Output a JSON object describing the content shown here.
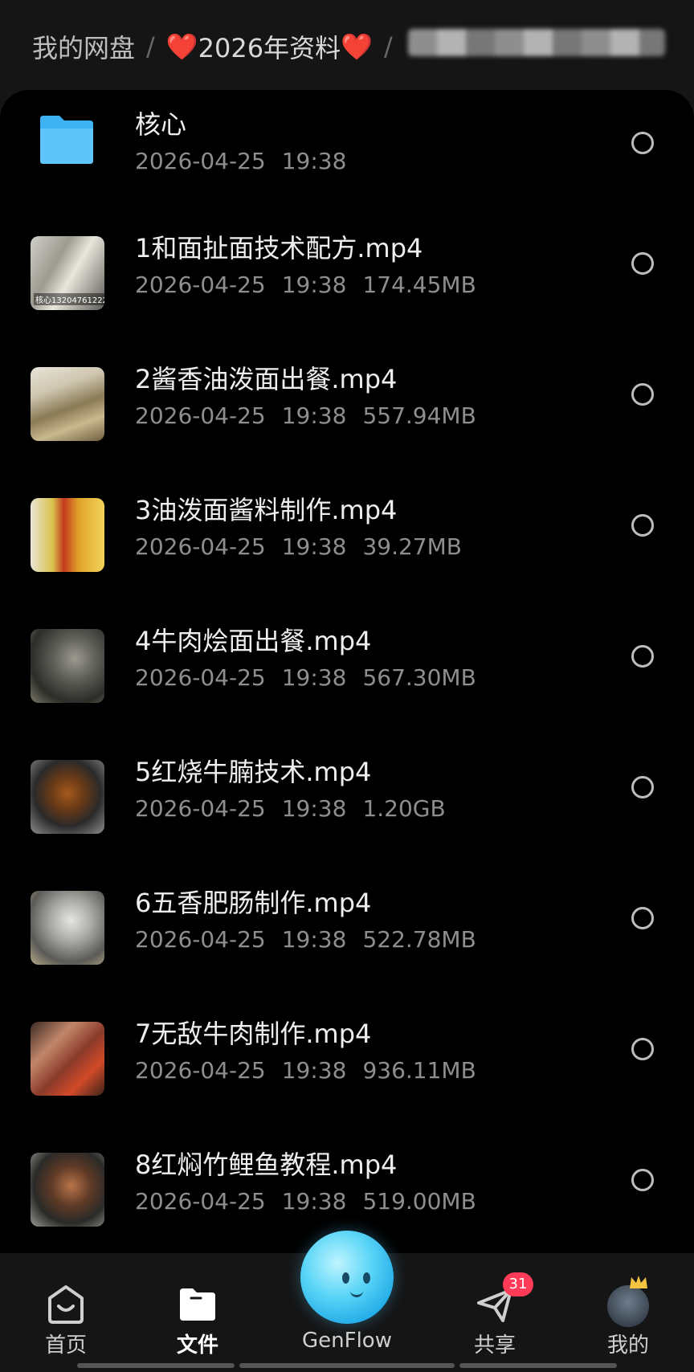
{
  "breadcrumb": {
    "root": "我的网盘",
    "separator": "/",
    "folder_left_heart": "❤️",
    "folder_name": "2026年资料",
    "folder_right_heart": "❤️"
  },
  "files": [
    {
      "name": "核心",
      "date": "2026-04-25",
      "time": "19:38",
      "size": "",
      "kind": "folder"
    },
    {
      "name": "1和面扯面技术配方.mp4",
      "date": "2026-04-25",
      "time": "19:38",
      "size": "174.45MB",
      "kind": "video",
      "thumb_text": "核心13204761222"
    },
    {
      "name": "2酱香油泼面出餐.mp4",
      "date": "2026-04-25",
      "time": "19:38",
      "size": "557.94MB",
      "kind": "video"
    },
    {
      "name": "3油泼面酱料制作.mp4",
      "date": "2026-04-25",
      "time": "19:38",
      "size": "39.27MB",
      "kind": "video"
    },
    {
      "name": "4牛肉烩面出餐.mp4",
      "date": "2026-04-25",
      "time": "19:38",
      "size": "567.30MB",
      "kind": "video"
    },
    {
      "name": "5红烧牛腩技术.mp4",
      "date": "2026-04-25",
      "time": "19:38",
      "size": "1.20GB",
      "kind": "video"
    },
    {
      "name": "6五香肥肠制作.mp4",
      "date": "2026-04-25",
      "time": "19:38",
      "size": "522.78MB",
      "kind": "video"
    },
    {
      "name": "7无敌牛肉制作.mp4",
      "date": "2026-04-25",
      "time": "19:38",
      "size": "936.11MB",
      "kind": "video"
    },
    {
      "name": "8红焖竹鲤鱼教程.mp4",
      "date": "2026-04-25",
      "time": "19:38",
      "size": "519.00MB",
      "kind": "video"
    }
  ],
  "nav": {
    "home": "首页",
    "files": "文件",
    "genflow": "GenFlow",
    "share": "共享",
    "share_badge": "31",
    "me": "我的"
  },
  "colors": {
    "background": "#000000",
    "header_bg": "#151515",
    "badge": "#ff3b57",
    "folder": "#3fb2f4"
  }
}
